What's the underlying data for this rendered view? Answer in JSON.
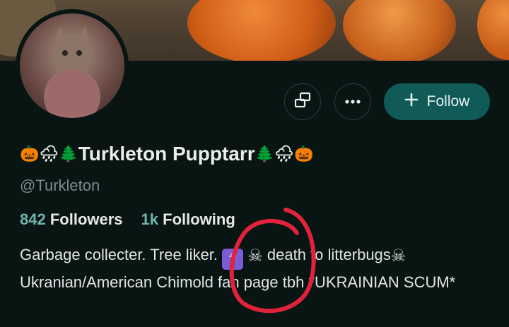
{
  "header": {
    "follow_label": "Follow",
    "follow_icon": "plus-icon",
    "message_icon": "message-icon",
    "more_icon": "more-icon"
  },
  "profile": {
    "name_prefix": "🎃🌧🌲",
    "name": "Turkleton Pupptarr",
    "name_suffix": "🌲🌧🎃",
    "handle": "@Turkleton",
    "followers_count": "842",
    "followers_label": "Followers",
    "following_count": "1k",
    "following_label": "Following",
    "bio_part1": "Garbage collecter. Tree liker. ",
    "bio_orthodox_cross": "☦",
    "bio_skull1": "☠",
    "bio_part2": " death to litterbugs",
    "bio_skull2": "☠",
    "bio_part3": " Ukranian/American Chimold fan page tbh *UKRAINIAN SCUM*"
  },
  "colors": {
    "background": "#081513",
    "accent": "#105a57",
    "stat_number": "#6fb3ad",
    "handle": "#7c8b89",
    "annotation": "#e0233a"
  }
}
